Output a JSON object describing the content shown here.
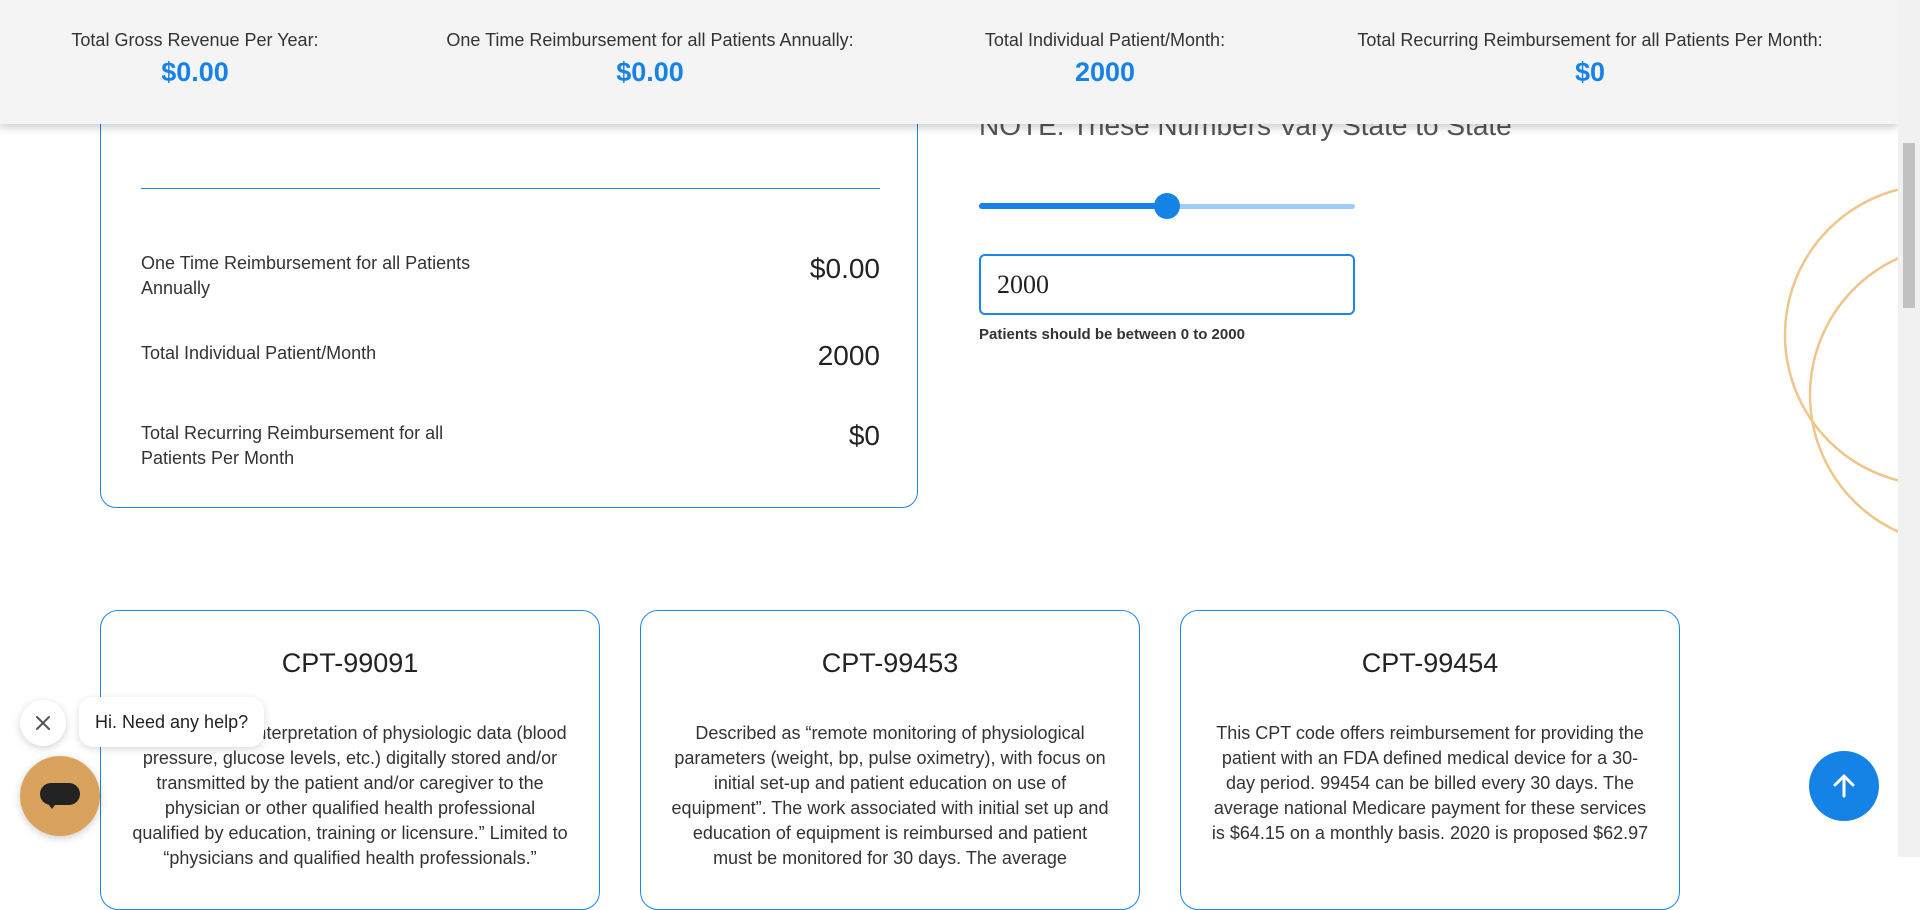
{
  "summary": {
    "stats": [
      {
        "label": "Total Gross Revenue Per Year:",
        "value": "$0.00"
      },
      {
        "label": "One Time Reimbursement for all Patients Annually:",
        "value": "$0.00"
      },
      {
        "label": "Total Individual Patient/Month:",
        "value": "2000"
      },
      {
        "label": "Total Recurring Reimbursement for all Patients Per Month:",
        "value": "$0"
      }
    ]
  },
  "calculator": {
    "rows": [
      {
        "label": "One Time Reimbursement for all Patients Annually",
        "value": "$0.00"
      },
      {
        "label": "Total Individual Patient/Month",
        "value": "2000"
      },
      {
        "label": "Total Recurring Reimbursement for all Patients Per Month",
        "value": "$0"
      }
    ]
  },
  "controls": {
    "note": "NOTE: These Numbers Vary State to State",
    "slider_fraction": 0.5,
    "patients_value": "2000",
    "hint": "Patients should be between 0 to 2000"
  },
  "cpt_cards": [
    {
      "title": "CPT-99091",
      "text": "Collection and interpretation of physiologic data (blood pressure, glucose levels, etc.) digitally stored and/or transmitted by the patient and/or caregiver to the physician or other qualified health professional qualified by education, training or licensure.” Limited to “physicians and qualified health professionals.”"
    },
    {
      "title": "CPT-99453",
      "text": "Described as “remote monitoring of physiological parameters (weight, bp, pulse oximetry), with focus on initial set-up and patient education on use of equipment”. The work associated with initial set up and education of equipment is reimbursed and patient must be monitored for 30 days. The average"
    },
    {
      "title": "CPT-99454",
      "text": "This CPT code offers reimbursement for providing the patient with an FDA defined medical device for a 30-day period. 99454 can be billed every 30 days. The average national Medicare payment for these services is $64.15 on a monthly basis. 2020 is proposed $62.97"
    }
  ],
  "chat": {
    "greeting": "Hi. Need any help?",
    "close_icon": "close-icon",
    "launcher_icon": "chat-bubble-icon"
  },
  "back_to_top_icon": "arrow-up-icon",
  "colors": {
    "accent": "#1582e6",
    "card_border": "#1a86e8",
    "chat_launcher": "#d9a35e",
    "decor_arc": "#efc58a"
  }
}
